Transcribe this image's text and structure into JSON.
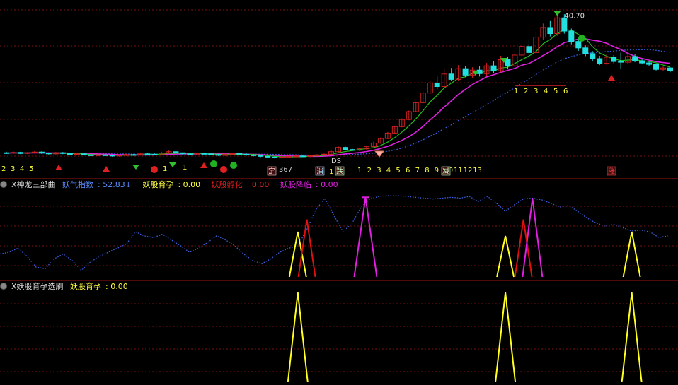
{
  "colors": {
    "bg": "#000000",
    "grid": "#7a1010",
    "divider": "#a01515",
    "up": "#d42020",
    "down": "#22e0e0",
    "blue_line": "#3a5fe0",
    "magenta": "#e020e0",
    "green_line": "#20c020",
    "yellow": "#ffff20",
    "red_spike": "#e01010",
    "label_yellow": "#ffff40"
  },
  "chart_data": [
    {
      "type": "candlestick",
      "panel": "main",
      "ylim": [
        -2,
        43
      ],
      "high_label": "40.70",
      "candles": [
        [
          1.5,
          1.4,
          1.8,
          1.2
        ],
        [
          1.4,
          1.6,
          1.9,
          1.2
        ],
        [
          1.6,
          1.3,
          1.8,
          1.1
        ],
        [
          1.3,
          1.5,
          1.7,
          1.1
        ],
        [
          1.5,
          1.7,
          2.0,
          1.3
        ],
        [
          1.7,
          1.4,
          1.9,
          1.2
        ],
        [
          1.4,
          1.2,
          1.6,
          1.0
        ],
        [
          1.2,
          1.5,
          1.7,
          1.0
        ],
        [
          1.5,
          1.3,
          1.7,
          1.1
        ],
        [
          1.3,
          1.0,
          1.5,
          0.8
        ],
        [
          1.0,
          1.2,
          1.4,
          0.8
        ],
        [
          1.2,
          0.9,
          1.4,
          0.7
        ],
        [
          0.9,
          0.7,
          1.1,
          0.5
        ],
        [
          0.7,
          0.9,
          1.1,
          0.5
        ],
        [
          0.9,
          0.8,
          1.1,
          0.6
        ],
        [
          0.8,
          0.6,
          1.0,
          0.4
        ],
        [
          0.6,
          0.8,
          1.0,
          0.4
        ],
        [
          0.8,
          1.0,
          1.2,
          0.6
        ],
        [
          1.0,
          0.9,
          1.2,
          0.7
        ],
        [
          0.9,
          1.2,
          1.4,
          0.7
        ],
        [
          1.2,
          1.1,
          1.4,
          0.9
        ],
        [
          1.1,
          1.0,
          1.3,
          0.8
        ],
        [
          1.0,
          1.4,
          1.7,
          0.8
        ],
        [
          1.4,
          1.8,
          2.1,
          1.2
        ],
        [
          1.8,
          1.5,
          2.0,
          1.3
        ],
        [
          1.5,
          1.2,
          1.7,
          1.0
        ],
        [
          1.2,
          1.1,
          1.4,
          0.9
        ],
        [
          1.1,
          1.3,
          1.5,
          0.9
        ],
        [
          1.3,
          1.2,
          1.5,
          1.0
        ],
        [
          1.2,
          1.0,
          1.4,
          0.8
        ],
        [
          1.0,
          0.8,
          1.2,
          0.6
        ],
        [
          0.8,
          1.1,
          1.3,
          0.6
        ],
        [
          1.1,
          1.3,
          1.5,
          0.9
        ],
        [
          1.3,
          1.1,
          1.5,
          0.9
        ],
        [
          1.1,
          0.9,
          1.3,
          0.7
        ],
        [
          0.9,
          0.7,
          1.1,
          0.5
        ],
        [
          0.7,
          0.5,
          0.9,
          0.3
        ],
        [
          0.5,
          0.3,
          0.7,
          0.1
        ],
        [
          0.3,
          0.1,
          0.5,
          -0.1
        ],
        [
          0.1,
          0.3,
          0.5,
          -0.1
        ],
        [
          0.3,
          0.5,
          0.7,
          0.1
        ],
        [
          0.5,
          0.6,
          0.8,
          0.3
        ],
        [
          0.6,
          0.5,
          0.8,
          0.3
        ],
        [
          0.5,
          0.7,
          0.9,
          0.3
        ],
        [
          0.7,
          0.9,
          1.1,
          0.5
        ],
        [
          0.9,
          1.1,
          1.3,
          0.7
        ],
        [
          1.1,
          1.8,
          2.2,
          0.9
        ],
        [
          1.8,
          3.0,
          3.3,
          1.6
        ],
        [
          3.0,
          2.4,
          3.2,
          2.2
        ],
        [
          2.4,
          2.2,
          2.6,
          2.0
        ],
        [
          2.2,
          2.6,
          2.8,
          2.0
        ],
        [
          2.6,
          3.2,
          3.5,
          2.4
        ],
        [
          3.2,
          4.2,
          4.6,
          3.0
        ],
        [
          4.2,
          5.5,
          5.8,
          4.0
        ],
        [
          5.5,
          7.0,
          7.3,
          5.3
        ],
        [
          7.0,
          8.8,
          9.1,
          6.8
        ],
        [
          8.8,
          10.8,
          11.1,
          8.6
        ],
        [
          10.8,
          13.0,
          13.3,
          10.6
        ],
        [
          13.0,
          15.5,
          15.8,
          12.8
        ],
        [
          15.5,
          18.2,
          18.5,
          15.3
        ],
        [
          18.2,
          21.0,
          21.5,
          18.0
        ],
        [
          21.0,
          20.0,
          22.8,
          19.2
        ],
        [
          20.0,
          23.5,
          24.8,
          19.6
        ],
        [
          23.5,
          22.0,
          25.2,
          21.5
        ],
        [
          22.0,
          25.0,
          26.0,
          21.5
        ],
        [
          25.0,
          23.2,
          25.8,
          22.6
        ],
        [
          23.2,
          24.6,
          25.4,
          22.4
        ],
        [
          24.6,
          23.6,
          25.8,
          22.8
        ],
        [
          23.6,
          25.8,
          26.6,
          23.0
        ],
        [
          25.8,
          24.4,
          27.0,
          23.8
        ],
        [
          24.4,
          27.5,
          28.6,
          24.0
        ],
        [
          27.5,
          25.8,
          28.4,
          25.0
        ],
        [
          25.8,
          28.8,
          30.2,
          25.2
        ],
        [
          28.8,
          31.2,
          32.5,
          28.2
        ],
        [
          31.2,
          29.5,
          33.0,
          28.8
        ],
        [
          29.5,
          33.8,
          35.2,
          29.0
        ],
        [
          33.8,
          36.5,
          37.6,
          33.0
        ],
        [
          36.5,
          34.8,
          38.3,
          34.0
        ],
        [
          34.8,
          39.2,
          40.7,
          34.2
        ],
        [
          39.2,
          35.5,
          40.2,
          34.8
        ],
        [
          35.5,
          32.6,
          36.2,
          31.8
        ],
        [
          32.6,
          30.8,
          33.6,
          30.0
        ],
        [
          30.8,
          29.2,
          31.5,
          28.5
        ],
        [
          29.2,
          27.8,
          29.9,
          27.0
        ],
        [
          27.8,
          26.5,
          28.6,
          26.0
        ],
        [
          26.5,
          28.2,
          29.0,
          26.0
        ],
        [
          28.2,
          27.0,
          28.8,
          26.5
        ],
        [
          27.0,
          26.8,
          29.5,
          25.0
        ],
        [
          26.8,
          28.4,
          29.4,
          26.2
        ],
        [
          28.4,
          27.2,
          29.0,
          26.8
        ],
        [
          27.2,
          26.6,
          27.8,
          26.2
        ],
        [
          26.6,
          26.2,
          27.0,
          25.8
        ],
        [
          26.2,
          24.8,
          26.4,
          24.5
        ],
        [
          24.8,
          25.2,
          25.6,
          24.4
        ],
        [
          25.2,
          24.4,
          25.4,
          24.0
        ]
      ],
      "up_count_labels": [
        "1",
        "2",
        "3",
        "4",
        "5",
        "6",
        "7",
        "8",
        "9",
        "10",
        "11",
        "12",
        "13"
      ],
      "top_count_labels": [
        "1",
        "2",
        "3",
        "4",
        "5",
        "6"
      ],
      "left_labels": [
        "2",
        "3",
        "4",
        "5"
      ],
      "misc_labels": [
        "1",
        "1",
        "1",
        "2",
        "367",
        "DS"
      ],
      "badge_labels": [
        "定",
        "消",
        "跌",
        "减",
        "涨"
      ]
    },
    {
      "type": "line",
      "panel": "indicator_1",
      "title": "X神龙三部曲",
      "legend": [
        {
          "name": "妖气指数",
          "value": "52.83↓"
        },
        {
          "name": "妖股育孕",
          "value": "0.00"
        },
        {
          "name": "妖股孵化",
          "value": "0.00"
        },
        {
          "name": "妖股降临",
          "value": "0.00"
        }
      ],
      "ylim": [
        0,
        105
      ],
      "series": [
        {
          "name": "妖气指数",
          "style": "dotted",
          "values": [
            28,
            30,
            35,
            25,
            12,
            10,
            22,
            28,
            20,
            8,
            18,
            25,
            30,
            35,
            40,
            55,
            50,
            48,
            52,
            45,
            38,
            30,
            35,
            42,
            50,
            45,
            38,
            28,
            20,
            16,
            22,
            30,
            35,
            38,
            58,
            82,
            96,
            75,
            55,
            65,
            85,
            95,
            98,
            99,
            99,
            98,
            97,
            96,
            95,
            96,
            97,
            96,
            98,
            92,
            98,
            90,
            80,
            88,
            95,
            96,
            94,
            90,
            85,
            87,
            80,
            72,
            66,
            62,
            64,
            60,
            56,
            57,
            55,
            48,
            50
          ]
        }
      ],
      "spikes_yellow": [
        [
          33,
          55
        ],
        [
          56,
          50
        ],
        [
          70,
          55
        ]
      ],
      "spikes_red": [
        [
          34,
          70
        ],
        [
          58,
          70
        ]
      ],
      "spikes_magenta": [
        [
          40,
          97
        ],
        [
          41,
          97
        ],
        [
          59,
          96
        ]
      ]
    },
    {
      "type": "line",
      "panel": "indicator_2",
      "title": "X妖股育孕选刷",
      "legend": [
        {
          "name": "妖股育孕",
          "value": "0.00"
        }
      ],
      "ylim": [
        0,
        100
      ],
      "spikes_yellow": [
        [
          33,
          100
        ],
        [
          56,
          100
        ],
        [
          70,
          100
        ]
      ]
    }
  ]
}
